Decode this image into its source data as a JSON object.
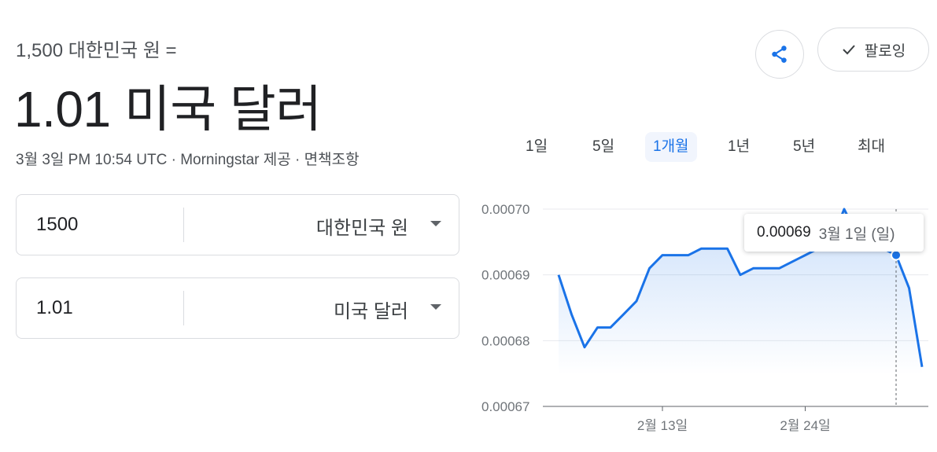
{
  "header": {
    "subtitle": "1,500 대한민국 원 =",
    "headline": "1.01 미국 달러",
    "meta": "3월 3일 PM 10:54 UTC · Morningstar 제공 · 면책조항"
  },
  "actions": {
    "share_icon": "share-icon",
    "follow_label": "팔로잉"
  },
  "converter": [
    {
      "value": "1500",
      "currency": "대한민국 원"
    },
    {
      "value": "1.01",
      "currency": "미국 달러"
    }
  ],
  "range_tabs": [
    {
      "label": "1일",
      "active": false
    },
    {
      "label": "5일",
      "active": false
    },
    {
      "label": "1개월",
      "active": true
    },
    {
      "label": "1년",
      "active": false
    },
    {
      "label": "5년",
      "active": false
    },
    {
      "label": "최대",
      "active": false
    }
  ],
  "tooltip": {
    "value": "0.00069",
    "date": "3월 1일 (일)"
  },
  "colors": {
    "line": "#1a73e8",
    "accent": "#1a73e8",
    "grid": "#e8eaed"
  },
  "chart_data": {
    "type": "area",
    "y_ticks": [
      "0.00070",
      "0.00069",
      "0.00068",
      "0.00067"
    ],
    "y_tick_values": [
      0.0007,
      0.00069,
      0.00068,
      0.00067
    ],
    "ylim": [
      0.00067,
      0.0007
    ],
    "x_ticks": [
      "2월 13일",
      "2월 24일"
    ],
    "series": [
      {
        "values": [
          0.00069,
          0.000684,
          0.000679,
          0.000682,
          0.000682,
          0.000684,
          0.000686,
          0.000691,
          0.000693,
          0.000693,
          0.000693,
          0.000694,
          0.000694,
          0.000694,
          0.00069,
          0.000691,
          0.000691,
          0.000691,
          0.000692,
          0.000693,
          0.000694,
          0.000695,
          0.0007,
          0.000696,
          0.000694,
          0.000694,
          0.000693,
          0.000688,
          0.000676
        ]
      }
    ],
    "x_tick_indices": [
      8,
      19
    ],
    "hover_index": 26,
    "grid": true
  }
}
